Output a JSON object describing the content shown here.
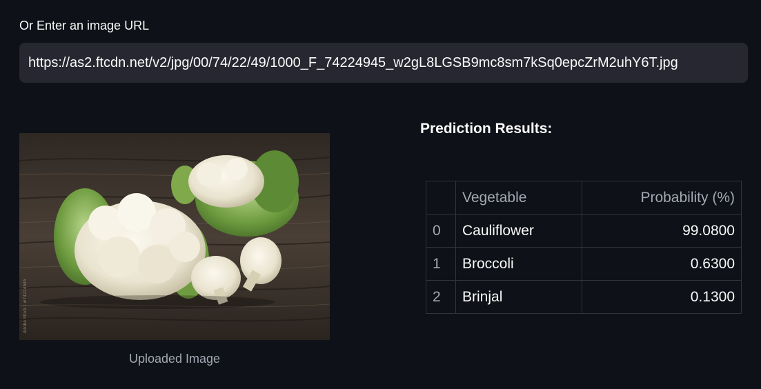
{
  "url_section": {
    "label": "Or Enter an image URL",
    "value": "https://as2.ftcdn.net/v2/jpg/00/74/22/49/1000_F_74224945_w2gL8LGSB9mc8sm7kSq0epcZrM2uhY6T.jpg"
  },
  "image": {
    "caption": "Uploaded Image",
    "subject": "cauliflower-photo"
  },
  "results": {
    "title": "Prediction Results:",
    "columns": [
      "",
      "Vegetable",
      "Probability (%)"
    ],
    "rows": [
      {
        "index": "0",
        "vegetable": "Cauliflower",
        "probability": "99.0800"
      },
      {
        "index": "1",
        "vegetable": "Broccoli",
        "probability": "0.6300"
      },
      {
        "index": "2",
        "vegetable": "Brinjal",
        "probability": "0.1300"
      }
    ]
  }
}
